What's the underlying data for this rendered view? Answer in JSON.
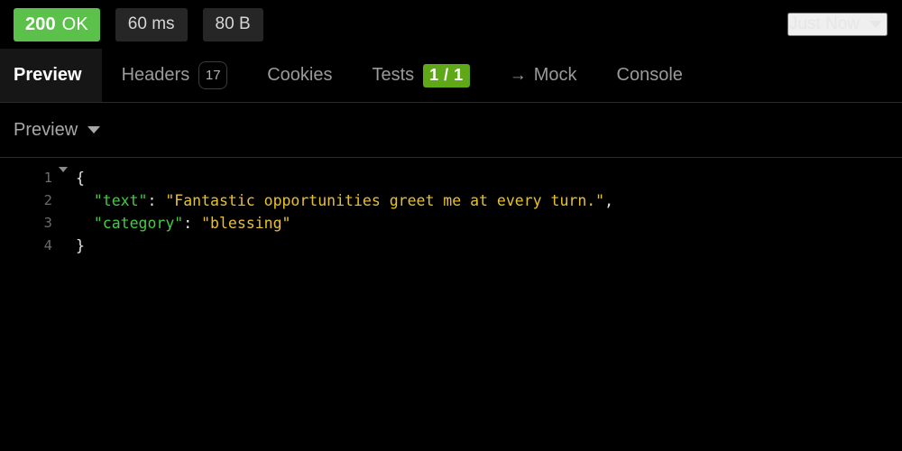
{
  "status_bar": {
    "status_code": "200",
    "status_phrase": "OK",
    "status_color": "#5cc14a",
    "duration": "60 ms",
    "size": "80 B",
    "time_label": "Just Now",
    "time_caret_icon": "chevron-down-icon"
  },
  "tabs": [
    {
      "label": "Preview",
      "active": true,
      "badge": null,
      "badge_type": "none"
    },
    {
      "label": "Headers",
      "active": false,
      "badge": "17",
      "badge_type": "count"
    },
    {
      "label": "Cookies",
      "active": false,
      "badge": null,
      "badge_type": "none"
    },
    {
      "label": "Tests",
      "active": false,
      "badge": "1 / 1",
      "badge_type": "pass"
    },
    {
      "label": "Mock",
      "active": false,
      "badge": null,
      "badge_type": "none",
      "prefix_icon": "arrow-right-icon",
      "prefix_glyph": "→"
    },
    {
      "label": "Console",
      "active": false,
      "badge": null,
      "badge_type": "none"
    }
  ],
  "view_bar": {
    "mode_label": "Preview",
    "caret_icon": "chevron-down-icon"
  },
  "code": {
    "language": "json",
    "raw": "{\n  \"text\": \"Fantastic opportunities greet me at every turn.\",\n  \"category\": \"blessing\"\n}",
    "lines": [
      {
        "number": "1",
        "foldable": true,
        "tokens": [
          {
            "text": "{",
            "type": "punct"
          }
        ]
      },
      {
        "number": "2",
        "foldable": false,
        "tokens": [
          {
            "text": "  ",
            "type": "punct"
          },
          {
            "text": "\"text\"",
            "type": "key"
          },
          {
            "text": ": ",
            "type": "punct"
          },
          {
            "text": "\"Fantastic opportunities greet me at every turn.\"",
            "type": "str"
          },
          {
            "text": ",",
            "type": "punct"
          }
        ]
      },
      {
        "number": "3",
        "foldable": false,
        "tokens": [
          {
            "text": "  ",
            "type": "punct"
          },
          {
            "text": "\"category\"",
            "type": "key"
          },
          {
            "text": ": ",
            "type": "punct"
          },
          {
            "text": "\"blessing\"",
            "type": "str"
          }
        ]
      },
      {
        "number": "4",
        "foldable": false,
        "tokens": [
          {
            "text": "}",
            "type": "punct"
          }
        ]
      }
    ]
  },
  "theme": {
    "background": "#000000",
    "key_color": "#3fcf3f",
    "string_color": "#e8c22e",
    "punct_color": "#e4e4e4",
    "gutter_color": "#6b6b6b",
    "accent_green": "#5cc14a",
    "pass_green": "#5fa818"
  }
}
